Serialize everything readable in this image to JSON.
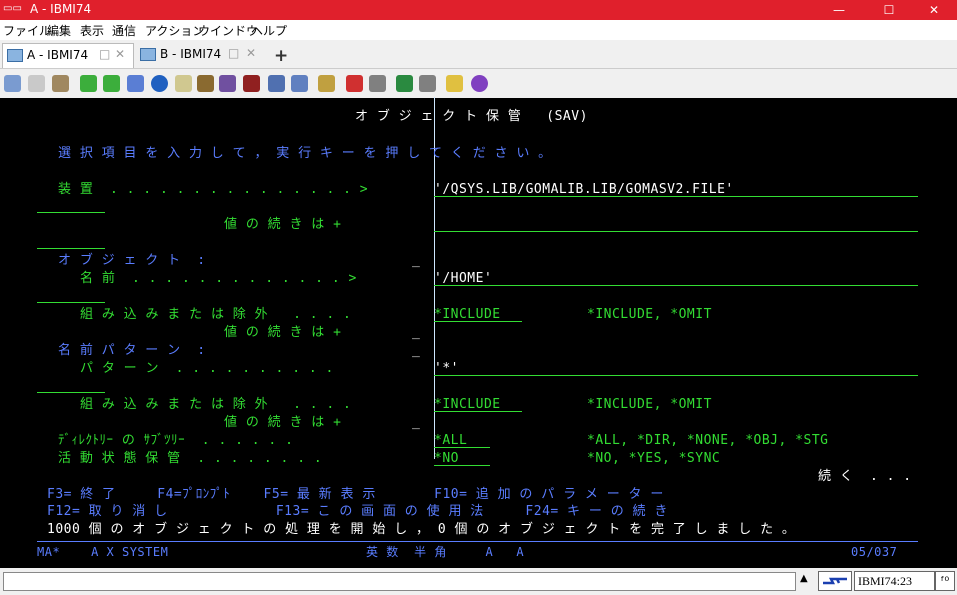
{
  "window": {
    "title": "A - IBMI74",
    "minimize": "—",
    "maximize": "☐",
    "close": "✕"
  },
  "menu": [
    "ファイル",
    "編集",
    "表示",
    "通信",
    "アクション",
    "ウインドウ",
    "ヘルプ"
  ],
  "tabs": [
    {
      "label": "A - IBMI74",
      "active": true
    },
    {
      "label": "B - IBMI74",
      "active": false
    }
  ],
  "add_tab": "+",
  "toolbar_icons": [
    "copy-icon",
    "paste-icon",
    "lock-icon",
    "upload-icon",
    "download-icon",
    "save-icon",
    "compass-icon",
    "macro-icon",
    "box-icon",
    "record-icon",
    "keypad-icon",
    "mail-icon",
    "grid-icon",
    "tools-icon",
    "play-icon",
    "stop-icon",
    "play2-icon",
    "pause-icon",
    "notes-icon",
    "help-icon"
  ],
  "screen": {
    "title": "オ ブ ジ ェ ク ト 保 管   (SAV)",
    "instruction": "選 択 項 目 を 入 力 し て ， 実 行 キ ー を 押 し て く だ さ い 。",
    "device_label": "装 置  . . . . . . . . . . . . . . . >",
    "device_value": "'/QSYS.LIB/GOMALIB.LIB/GOMASV2.FILE'",
    "more_values_1": "値 の 続 き は +",
    "object_label": "オ ブ ジ ェ ク ト  :",
    "object_mark": "_",
    "name_label": "名 前  . . . . . . . . . . . . . >",
    "name_value": "'/HOME'",
    "include_label_1": "組 み 込 み ま た は 除 外   . . . .",
    "include_value_1": "*INCLUDE",
    "include_options_1": "*INCLUDE, *OMIT",
    "more_values_2": "値 の 続 き は +",
    "more_mark_2": "_",
    "pattern_label": "名 前 パ タ ー ン  :",
    "pattern_mark": "_",
    "pattern_sub_label": "パ タ ー ン  . . . . . . . . . .",
    "pattern_value": "'*'",
    "include_label_2": "組 み 込 み ま た は 除 外   . . . .",
    "include_value_2": "*INCLUDE",
    "include_options_2": "*INCLUDE, *OMIT",
    "more_values_3": "値 の 続 き は +",
    "more_mark_3": "_",
    "subtree_label": "ﾃﾞｨﾚｸﾄﾘｰ の ｻﾌﾞﾂﾘｰ  . . . . . .",
    "subtree_value": "*ALL",
    "subtree_options": "*ALL, *DIR, *NONE, *OBJ, *STG",
    "active_save_label": "活 動 状 態 保 管  . . . . . . . .",
    "active_save_value": "*NO",
    "active_save_options": "*NO, *YES, *SYNC",
    "more": "続 く  . . .",
    "fkeys_row1": "F3= 終 了     F4=ﾌﾟﾛﾝﾌﾟﾄ    F5= 最 新 表 示       F10= 追 加 の パ ラ メ ー タ ー",
    "fkeys_row2": "F12= 取 り 消 し             F13= こ の 画 面 の 使 用 法     F24= キ ー の 続 き",
    "message": "1000 個 の オ ブ ジ ェ ク ト の 処 理 を 開 始 し ， 0 個 の オ ブ ジ ェ ク ト を 完 了 し ま し た 。",
    "oia_left": "MA*    A X SYSTEM",
    "oia_mode": "英 数  半 角     A   A",
    "oia_cursor": "05/037"
  },
  "statusbar": {
    "arrow": "▲",
    "system": "IBMI74:23"
  }
}
